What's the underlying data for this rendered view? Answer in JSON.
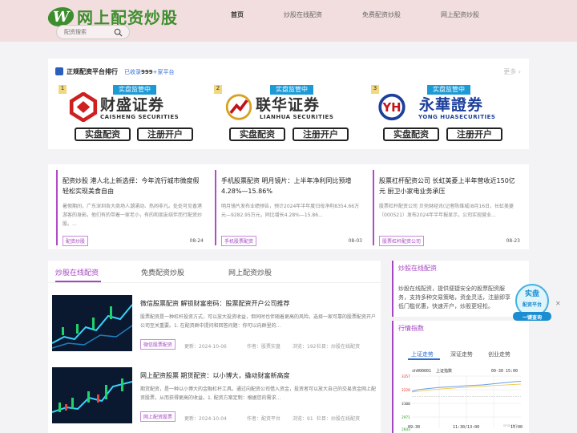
{
  "header": {
    "logo_mark": "W",
    "logo_text": "网上配资炒股",
    "search_placeholder": "配资搜索",
    "nav": [
      "首页",
      "炒股在线配资",
      "免费配资炒股",
      "网上配资炒股"
    ]
  },
  "ranking": {
    "title": "正规配资平台排行",
    "subtitle_prefix": "已收录",
    "subtitle_count": "999",
    "subtitle_suffix": "+家平台",
    "more": "更多",
    "brands": [
      {
        "rank": "1",
        "tag": "实盘监管中",
        "name": "财盛证券",
        "en": "CAISHENG SECURITIES",
        "btn1": "实盘配资",
        "btn2": "注册开户",
        "color": "#cf1f1f"
      },
      {
        "rank": "2",
        "tag": "实盘监管中",
        "name": "联华证券",
        "en": "LIANHUA SECURITIES",
        "btn1": "实盘配资",
        "btn2": "注册开户",
        "color": "#c0141b"
      },
      {
        "rank": "3",
        "tag": "实盘监管中",
        "name": "永華證券",
        "en": "YONG HUASECURITIES",
        "btn1": "实盘配资",
        "btn2": "注册开户",
        "color": "#1c3f9b"
      }
    ]
  },
  "news": [
    {
      "title": "配资炒股 港人北上新选择：今年流行城市微度假轻松实现美食自由",
      "desc": "暑假期间，广东深圳各大商场人潮涌动、热闹非凡。处处可见香港游客的身影。他们有的带着一家老小，有的和朋友结伴而行配资炒股。...",
      "tag": "配资炒股",
      "date": "08-24"
    },
    {
      "title": "手机股票配资 明月镜片：上半年净利同比预增4.28%—15.86%",
      "desc": "明月镜片发布业绩预告，预计2024年半年度归母净利8354.66万元—9282.95万元，同比增长4.28%—15.86...",
      "tag": "手机股票配资",
      "date": "08-03"
    },
    {
      "title": "股票杠杆配资公司 长虹美菱上半年营收近150亿元 厨卫小家电业务承压",
      "desc": "股票杠杆配资公司 贝壳财经讯(记者陈维城)8月16日，长虹美菱（000521）发布2024年半年报显示，公司实现营业...",
      "tag": "股票杠杆配资公司",
      "date": "08-23"
    }
  ],
  "main": {
    "tabs": [
      "炒股在线配资",
      "免费配资炒股",
      "网上配资炒股"
    ],
    "articles": [
      {
        "title": "微信股票配资 解锁财富密码：股票配资开户公司推荐",
        "desc": "股票配资是一种杠杆投资方式，可以放大投资收益，但同时也伴随着更高的风险。选择一家可靠的股票配资开户公司至关重要。1. 在配资群中提问和回答问题：你可以向群里的...",
        "tag": "微信股票配资",
        "updated": "更新：2024-10-06",
        "author": "作者：股票实盘",
        "views": "浏览：192",
        "column": "栏目：炒股在线配资"
      },
      {
        "title": "网上配资股票 期货配资：以小博大，撬动财富新高度",
        "desc": "期货配资，是一种以小博大的金融杠杆工具。通过向配资公司借入资金，投资者可以放大自己的交易资金网上配资股票，从而获得更高的收益。1. 配资方案定制：根据您的需求...",
        "tag": "网上配资股票",
        "updated": "更新：2024-10-04",
        "author": "作者：配资平台",
        "views": "浏览：91",
        "column": "栏目：炒股在线配资"
      }
    ]
  },
  "sidebar": {
    "box1_title": "炒股在线配资",
    "box1_desc": "炒股在线配资，提供便捷安全的股票配资服务，支持多种交易策略，资金灵活，注册即享低门槛优惠，快速开户，炒股更轻松。",
    "box2_title": "行情指数",
    "market_tabs": [
      "上证走势",
      "深证走势",
      "创业走势"
    ],
    "chart": {
      "code": "sh000001",
      "name": "上证指数",
      "datetime": "09-30 15:00",
      "y_ticks": [
        "3357",
        "3228",
        "3100",
        "2971",
        "2843"
      ],
      "x_ticks": [
        "09:30",
        "11:30/13:00",
        "15:00"
      ],
      "watermark": "sina.com"
    }
  },
  "float_badge": {
    "line1": "实盘",
    "line2": "配资平台",
    "line3": "一键查询",
    "close": "✕"
  }
}
